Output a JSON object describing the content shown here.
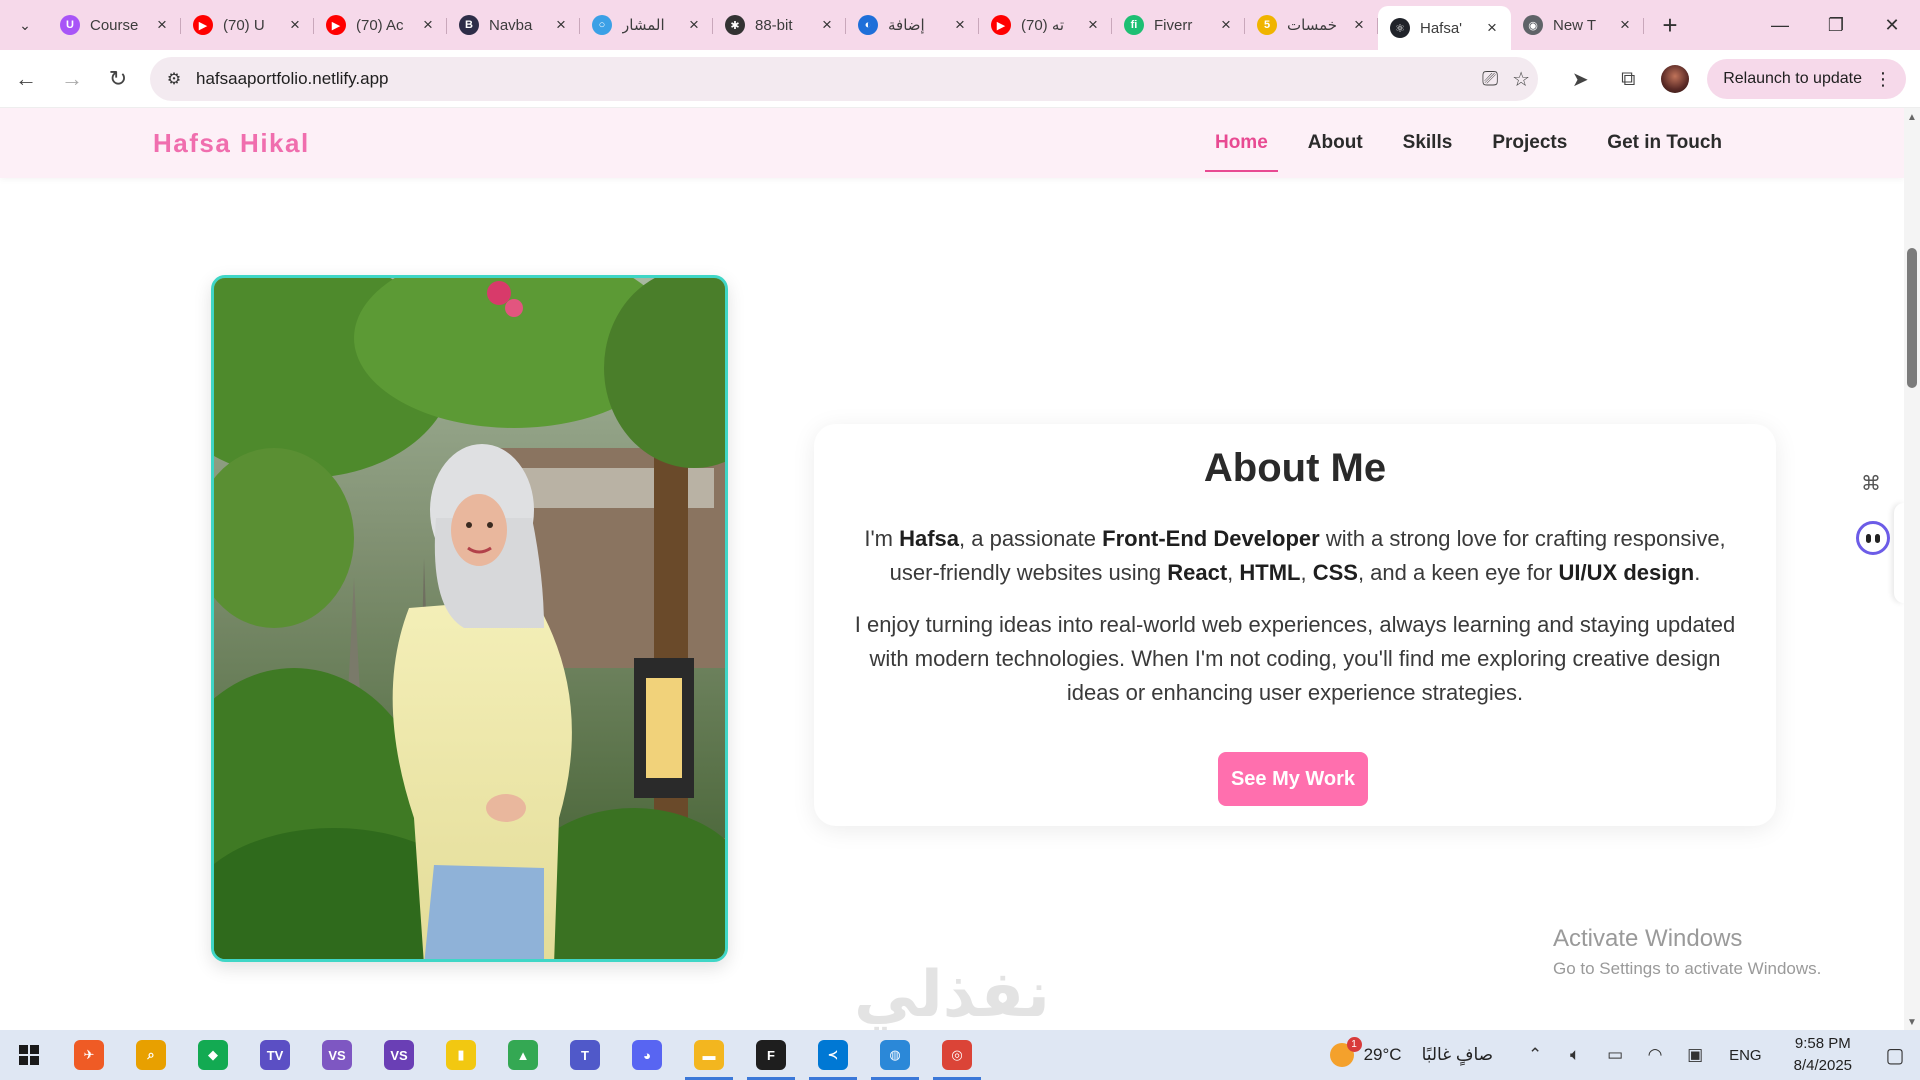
{
  "browser": {
    "tabs": [
      {
        "title": "Course",
        "favicon_color": "#a855f7",
        "favicon_glyph": "U",
        "active": false
      },
      {
        "title": "(70) U",
        "favicon_color": "#ff0000",
        "favicon_glyph": "▶",
        "active": false
      },
      {
        "title": "(70) Ac",
        "favicon_color": "#ff0000",
        "favicon_glyph": "▶",
        "active": false
      },
      {
        "title": "Navba",
        "favicon_color": "#2d2d48",
        "favicon_glyph": "B",
        "active": false
      },
      {
        "title": "المشار",
        "favicon_color": "#3ba0e6",
        "favicon_glyph": "○",
        "active": false
      },
      {
        "title": "88-bit",
        "favicon_color": "#333333",
        "favicon_glyph": "✱",
        "active": false
      },
      {
        "title": "إضافة",
        "favicon_color": "#1e6fd9",
        "favicon_glyph": "◐",
        "active": false
      },
      {
        "title": "(70) ته",
        "favicon_color": "#ff0000",
        "favicon_glyph": "▶",
        "active": false
      },
      {
        "title": "Fiverr",
        "favicon_color": "#1dbf73",
        "favicon_glyph": "fi",
        "active": false
      },
      {
        "title": "خمسات",
        "favicon_color": "#f0b400",
        "favicon_glyph": "5",
        "active": false
      },
      {
        "title": "Hafsa'",
        "favicon_color": "#20232a",
        "favicon_glyph": "⚛",
        "active": true
      },
      {
        "title": "New T",
        "favicon_color": "#5f6368",
        "favicon_glyph": "◉",
        "active": false
      }
    ],
    "url": "hafsaaportfolio.netlify.app",
    "relaunch_label": "Relaunch to update"
  },
  "site": {
    "brand": "Hafsa Hikal",
    "nav": [
      {
        "label": "Home",
        "active": true
      },
      {
        "label": "About",
        "active": false
      },
      {
        "label": "Skills",
        "active": false
      },
      {
        "label": "Projects",
        "active": false
      },
      {
        "label": "Get in Touch",
        "active": false
      }
    ],
    "about": {
      "title": "About Me",
      "p1": [
        {
          "t": "I'm ",
          "b": false
        },
        {
          "t": "Hafsa",
          "b": true
        },
        {
          "t": ", a passionate ",
          "b": false
        },
        {
          "t": "Front-End Developer",
          "b": true
        },
        {
          "t": " with a strong love for crafting responsive, user-friendly websites using ",
          "b": false
        },
        {
          "t": "React",
          "b": true
        },
        {
          "t": ", ",
          "b": false
        },
        {
          "t": "HTML",
          "b": true
        },
        {
          "t": ", ",
          "b": false
        },
        {
          "t": "CSS",
          "b": true
        },
        {
          "t": ", and a keen eye for ",
          "b": false
        },
        {
          "t": "UI/UX design",
          "b": true
        },
        {
          "t": ".",
          "b": false
        }
      ],
      "p2": "I enjoy turning ideas into real-world web experiences, always learning and staying updated with modern technologies. When I'm not coding, you'll find me exploring creative design ideas or enhancing user experience strategies.",
      "cta": "See My Work"
    },
    "colors": {
      "brand": "#f06eae",
      "accent": "#e84a92",
      "cta": "#ff6fae",
      "photo_border": "#3fd6c6"
    }
  },
  "overlay": {
    "activate_title": "Activate Windows",
    "activate_sub": "Go to Settings to activate Windows.",
    "watermark": "نفذلي"
  },
  "taskbar": {
    "apps": [
      {
        "name": "postman-icon",
        "color": "#ef5b25",
        "glyph": "✈",
        "running": false
      },
      {
        "name": "search-app-icon",
        "color": "#e8a000",
        "glyph": "⌕",
        "running": false
      },
      {
        "name": "mongodb-icon",
        "color": "#13aa52",
        "glyph": "◆",
        "running": false
      },
      {
        "name": "iptv-icon",
        "color": "#5b4fc4",
        "glyph": "TV",
        "running": false
      },
      {
        "name": "visual-studio-icon",
        "color": "#7e57c2",
        "glyph": "VS",
        "running": false
      },
      {
        "name": "visual-studio-2-icon",
        "color": "#6a3fb5",
        "glyph": "VS",
        "running": false
      },
      {
        "name": "power-bi-icon",
        "color": "#f2c811",
        "glyph": "▮",
        "running": false
      },
      {
        "name": "google-drive-icon",
        "color": "#34a853",
        "glyph": "▲",
        "running": false
      },
      {
        "name": "teams-icon",
        "color": "#5059c9",
        "glyph": "T",
        "running": false
      },
      {
        "name": "discord-icon",
        "color": "#5865f2",
        "glyph": "◕",
        "running": false
      },
      {
        "name": "file-explorer-icon",
        "color": "#f3b61f",
        "glyph": "▬",
        "running": true
      },
      {
        "name": "figma-icon",
        "color": "#1e1e1e",
        "glyph": "F",
        "running": true
      },
      {
        "name": "vscode-icon",
        "color": "#0078d4",
        "glyph": "≺",
        "running": true
      },
      {
        "name": "photos-icon",
        "color": "#2b88d8",
        "glyph": "◍",
        "running": true
      },
      {
        "name": "chrome-icon",
        "color": "#db4437",
        "glyph": "◎",
        "running": true
      }
    ],
    "weather_temp": "29°C",
    "weather_cond": "صافٍ غالبًا",
    "weather_badge": "1",
    "lang": "ENG",
    "time": "9:58 PM",
    "date": "8/4/2025"
  }
}
